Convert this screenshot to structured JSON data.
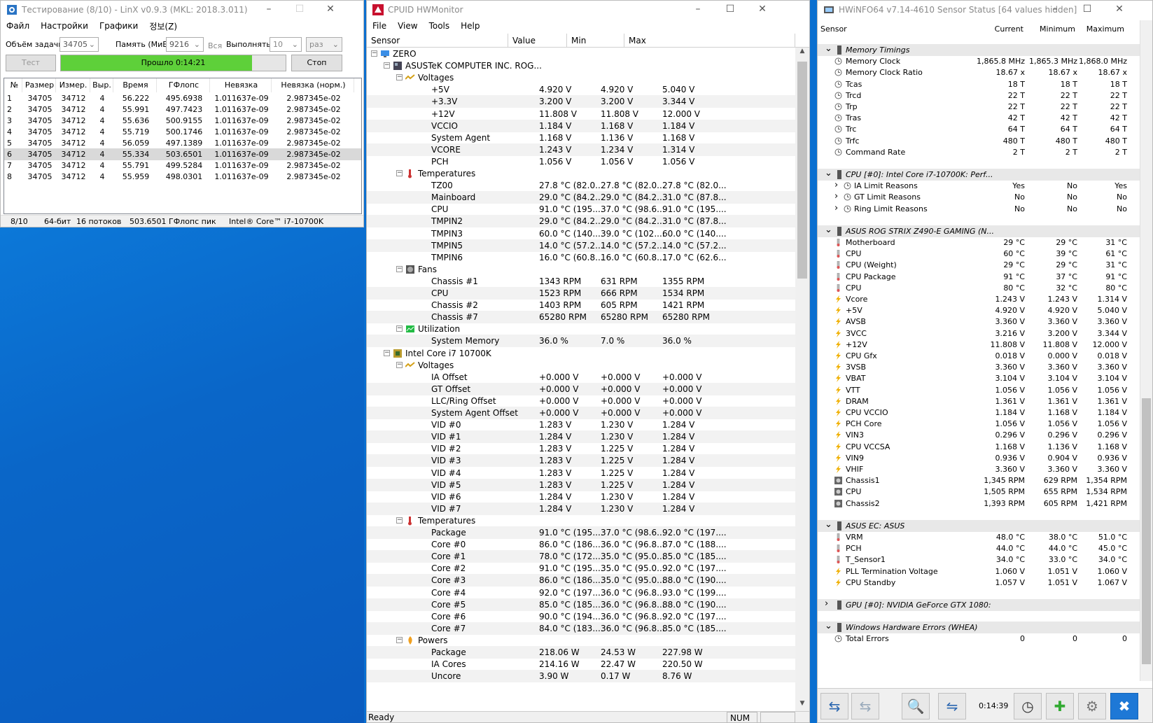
{
  "linx": {
    "title": "Тестирование (8/10) - LinX v0.9.3 (MKL: 2018.3.011)",
    "menu": [
      "Файл",
      "Настройки",
      "Графики",
      "정보(Z)"
    ],
    "task_size_label": "Объём задачи:",
    "task_size_value": "34705",
    "memory_label": "Память (МиБ):",
    "memory_value": "9216",
    "all_label": "Вся",
    "run_label": "Выполнять:",
    "run_value": "10",
    "run_unit": "раз",
    "test_button": "Тест",
    "progress_label": "Прошло 0:14:21",
    "progress_fraction": 0.85,
    "stop_button": "Стоп",
    "columns": [
      "№",
      "Размер",
      "Измер.",
      "Выр.",
      "Время",
      "ГФлопс",
      "Невязка",
      "Невязка (норм.)"
    ],
    "rows": [
      [
        "1",
        "34705",
        "34712",
        "4",
        "56.222",
        "495.6938",
        "1.011637e-09",
        "2.987345e-02"
      ],
      [
        "2",
        "34705",
        "34712",
        "4",
        "55.991",
        "497.7423",
        "1.011637e-09",
        "2.987345e-02"
      ],
      [
        "3",
        "34705",
        "34712",
        "4",
        "55.636",
        "500.9155",
        "1.011637e-09",
        "2.987345e-02"
      ],
      [
        "4",
        "34705",
        "34712",
        "4",
        "55.719",
        "500.1746",
        "1.011637e-09",
        "2.987345e-02"
      ],
      [
        "5",
        "34705",
        "34712",
        "4",
        "56.059",
        "497.1389",
        "1.011637e-09",
        "2.987345e-02"
      ],
      [
        "6",
        "34705",
        "34712",
        "4",
        "55.334",
        "503.6501",
        "1.011637e-09",
        "2.987345e-02"
      ],
      [
        "7",
        "34705",
        "34712",
        "4",
        "55.791",
        "499.5284",
        "1.011637e-09",
        "2.987345e-02"
      ],
      [
        "8",
        "34705",
        "34712",
        "4",
        "55.959",
        "498.0301",
        "1.011637e-09",
        "2.987345e-02"
      ]
    ],
    "status": [
      "8/10",
      "64-бит",
      "16 потоков",
      "503.6501 ГФлопс пик",
      "Intel® Core™ i7-10700K"
    ]
  },
  "hwmonitor": {
    "title": "CPUID HWMonitor",
    "menu": [
      "File",
      "View",
      "Tools",
      "Help"
    ],
    "columns": [
      "Sensor",
      "Value",
      "Min",
      "Max"
    ],
    "rows": [
      {
        "l": "ZERO",
        "d": 0,
        "t": "node",
        "ico": "pc"
      },
      {
        "l": "ASUSTeK COMPUTER INC. ROG...",
        "d": 1,
        "t": "node",
        "ico": "mb"
      },
      {
        "l": "Voltages",
        "d": 2,
        "t": "node",
        "ico": "volt"
      },
      {
        "l": "+5V",
        "d": 3,
        "v": "4.920 V",
        "mn": "4.920 V",
        "mx": "5.040 V"
      },
      {
        "l": "+3.3V",
        "d": 3,
        "v": "3.200 V",
        "mn": "3.200 V",
        "mx": "3.344 V"
      },
      {
        "l": "+12V",
        "d": 3,
        "v": "11.808 V",
        "mn": "11.808 V",
        "mx": "12.000 V"
      },
      {
        "l": "VCCIO",
        "d": 3,
        "v": "1.184 V",
        "mn": "1.168 V",
        "mx": "1.184 V"
      },
      {
        "l": "System Agent",
        "d": 3,
        "v": "1.168 V",
        "mn": "1.136 V",
        "mx": "1.168 V"
      },
      {
        "l": "VCORE",
        "d": 3,
        "v": "1.243 V",
        "mn": "1.234 V",
        "mx": "1.314 V"
      },
      {
        "l": "PCH",
        "d": 3,
        "v": "1.056 V",
        "mn": "1.056 V",
        "mx": "1.056 V"
      },
      {
        "l": "Temperatures",
        "d": 2,
        "t": "node",
        "ico": "temp"
      },
      {
        "l": "TZ00",
        "d": 3,
        "v": "27.8 °C (82.0...",
        "mn": "27.8 °C (82.0...",
        "mx": "27.8 °C (82.0..."
      },
      {
        "l": "Mainboard",
        "d": 3,
        "v": "29.0 °C (84.2...",
        "mn": "29.0 °C (84.2...",
        "mx": "31.0 °C (87.8..."
      },
      {
        "l": "CPU",
        "d": 3,
        "v": "91.0 °C (195....",
        "mn": "37.0 °C (98.6...",
        "mx": "91.0 °C (195...."
      },
      {
        "l": "TMPIN2",
        "d": 3,
        "v": "29.0 °C (84.2...",
        "mn": "29.0 °C (84.2...",
        "mx": "31.0 °C (87.8..."
      },
      {
        "l": "TMPIN3",
        "d": 3,
        "v": "60.0 °C (140....",
        "mn": "39.0 °C (102....",
        "mx": "60.0 °C (140...."
      },
      {
        "l": "TMPIN5",
        "d": 3,
        "v": "14.0 °C (57.2...",
        "mn": "14.0 °C (57.2...",
        "mx": "14.0 °C (57.2..."
      },
      {
        "l": "TMPIN6",
        "d": 3,
        "v": "16.0 °C (60.8...",
        "mn": "16.0 °C (60.8...",
        "mx": "17.0 °C (62.6..."
      },
      {
        "l": "Fans",
        "d": 2,
        "t": "node",
        "ico": "fan"
      },
      {
        "l": "Chassis #1",
        "d": 3,
        "v": "1343 RPM",
        "mn": "631 RPM",
        "mx": "1355 RPM"
      },
      {
        "l": "CPU",
        "d": 3,
        "v": "1523 RPM",
        "mn": "666 RPM",
        "mx": "1534 RPM"
      },
      {
        "l": "Chassis #2",
        "d": 3,
        "v": "1403 RPM",
        "mn": "605 RPM",
        "mx": "1421 RPM"
      },
      {
        "l": "Chassis #7",
        "d": 3,
        "v": "65280 RPM",
        "mn": "65280 RPM",
        "mx": "65280 RPM"
      },
      {
        "l": "Utilization",
        "d": 2,
        "t": "node",
        "ico": "util"
      },
      {
        "l": "System Memory",
        "d": 3,
        "v": "36.0 %",
        "mn": "7.0 %",
        "mx": "36.0 %"
      },
      {
        "l": "Intel Core i7 10700K",
        "d": 1,
        "t": "node",
        "ico": "cpu"
      },
      {
        "l": "Voltages",
        "d": 2,
        "t": "node",
        "ico": "volt"
      },
      {
        "l": "IA Offset",
        "d": 3,
        "v": "+0.000 V",
        "mn": "+0.000 V",
        "mx": "+0.000 V"
      },
      {
        "l": "GT Offset",
        "d": 3,
        "v": "+0.000 V",
        "mn": "+0.000 V",
        "mx": "+0.000 V"
      },
      {
        "l": "LLC/Ring Offset",
        "d": 3,
        "v": "+0.000 V",
        "mn": "+0.000 V",
        "mx": "+0.000 V"
      },
      {
        "l": "System Agent Offset",
        "d": 3,
        "v": "+0.000 V",
        "mn": "+0.000 V",
        "mx": "+0.000 V"
      },
      {
        "l": "VID #0",
        "d": 3,
        "v": "1.283 V",
        "mn": "1.230 V",
        "mx": "1.284 V"
      },
      {
        "l": "VID #1",
        "d": 3,
        "v": "1.284 V",
        "mn": "1.230 V",
        "mx": "1.284 V"
      },
      {
        "l": "VID #2",
        "d": 3,
        "v": "1.283 V",
        "mn": "1.225 V",
        "mx": "1.284 V"
      },
      {
        "l": "VID #3",
        "d": 3,
        "v": "1.283 V",
        "mn": "1.225 V",
        "mx": "1.284 V"
      },
      {
        "l": "VID #4",
        "d": 3,
        "v": "1.283 V",
        "mn": "1.225 V",
        "mx": "1.284 V"
      },
      {
        "l": "VID #5",
        "d": 3,
        "v": "1.283 V",
        "mn": "1.225 V",
        "mx": "1.284 V"
      },
      {
        "l": "VID #6",
        "d": 3,
        "v": "1.284 V",
        "mn": "1.230 V",
        "mx": "1.284 V"
      },
      {
        "l": "VID #7",
        "d": 3,
        "v": "1.284 V",
        "mn": "1.230 V",
        "mx": "1.284 V"
      },
      {
        "l": "Temperatures",
        "d": 2,
        "t": "node",
        "ico": "temp"
      },
      {
        "l": "Package",
        "d": 3,
        "v": "91.0 °C (195....",
        "mn": "37.0 °C (98.6...",
        "mx": "92.0 °C (197...."
      },
      {
        "l": "Core #0",
        "d": 3,
        "v": "86.0 °C (186....",
        "mn": "36.0 °C (96.8...",
        "mx": "87.0 °C (188...."
      },
      {
        "l": "Core #1",
        "d": 3,
        "v": "78.0 °C (172....",
        "mn": "35.0 °C (95.0...",
        "mx": "85.0 °C (185...."
      },
      {
        "l": "Core #2",
        "d": 3,
        "v": "91.0 °C (195....",
        "mn": "35.0 °C (95.0...",
        "mx": "92.0 °C (197...."
      },
      {
        "l": "Core #3",
        "d": 3,
        "v": "86.0 °C (186....",
        "mn": "35.0 °C (95.0...",
        "mx": "88.0 °C (190...."
      },
      {
        "l": "Core #4",
        "d": 3,
        "v": "92.0 °C (197....",
        "mn": "36.0 °C (96.8...",
        "mx": "93.0 °C (199...."
      },
      {
        "l": "Core #5",
        "d": 3,
        "v": "85.0 °C (185....",
        "mn": "36.0 °C (96.8...",
        "mx": "88.0 °C (190...."
      },
      {
        "l": "Core #6",
        "d": 3,
        "v": "90.0 °C (194....",
        "mn": "36.0 °C (96.8...",
        "mx": "92.0 °C (197...."
      },
      {
        "l": "Core #7",
        "d": 3,
        "v": "84.0 °C (183....",
        "mn": "36.0 °C (96.8...",
        "mx": "85.0 °C (185...."
      },
      {
        "l": "Powers",
        "d": 2,
        "t": "node",
        "ico": "power"
      },
      {
        "l": "Package",
        "d": 3,
        "v": "218.06 W",
        "mn": "24.53 W",
        "mx": "227.98 W"
      },
      {
        "l": "IA Cores",
        "d": 3,
        "v": "214.16 W",
        "mn": "22.47 W",
        "mx": "220.50 W"
      },
      {
        "l": "Uncore",
        "d": 3,
        "v": "3.90 W",
        "mn": "0.17 W",
        "mx": "8.76 W"
      }
    ],
    "status_ready": "Ready",
    "status_num": "NUM"
  },
  "hwinfo": {
    "title": "HWiNFO64 v7.14-4610 Sensor Status [64 values hidden]",
    "columns": [
      "Sensor",
      "Current",
      "Minimum",
      "Maximum"
    ],
    "rows": [
      {
        "t": "grp",
        "n": "Memory Timings"
      },
      {
        "n": "Memory Clock",
        "a": "1,865.8 MHz",
        "b": "1,865.3 MHz",
        "c": "1,868.0 MHz",
        "i": "clock"
      },
      {
        "n": "Memory Clock Ratio",
        "a": "18.67 x",
        "b": "18.67 x",
        "c": "18.67 x",
        "i": "clock"
      },
      {
        "n": "Tcas",
        "a": "18 T",
        "b": "18 T",
        "c": "18 T",
        "i": "clock"
      },
      {
        "n": "Trcd",
        "a": "22 T",
        "b": "22 T",
        "c": "22 T",
        "i": "clock"
      },
      {
        "n": "Trp",
        "a": "22 T",
        "b": "22 T",
        "c": "22 T",
        "i": "clock"
      },
      {
        "n": "Tras",
        "a": "42 T",
        "b": "42 T",
        "c": "42 T",
        "i": "clock"
      },
      {
        "n": "Trc",
        "a": "64 T",
        "b": "64 T",
        "c": "64 T",
        "i": "clock"
      },
      {
        "n": "Trfc",
        "a": "480 T",
        "b": "480 T",
        "c": "480 T",
        "i": "clock"
      },
      {
        "n": "Command Rate",
        "a": "2 T",
        "b": "2 T",
        "c": "2 T",
        "i": "clock"
      },
      {
        "t": "gap"
      },
      {
        "t": "grp",
        "n": "CPU [#0]: Intel Core i7-10700K: Perf..."
      },
      {
        "n": "IA Limit Reasons",
        "a": "Yes",
        "b": "No",
        "c": "Yes",
        "i": "clock",
        "e": true
      },
      {
        "n": "GT Limit Reasons",
        "a": "No",
        "b": "No",
        "c": "No",
        "i": "clock",
        "e": true
      },
      {
        "n": "Ring Limit Reasons",
        "a": "No",
        "b": "No",
        "c": "No",
        "i": "clock",
        "e": true
      },
      {
        "t": "gap"
      },
      {
        "t": "grp",
        "n": "ASUS ROG STRIX Z490-E GAMING (N..."
      },
      {
        "n": "Motherboard",
        "a": "29 °C",
        "b": "29 °C",
        "c": "31 °C",
        "i": "therm"
      },
      {
        "n": "CPU",
        "a": "60 °C",
        "b": "39 °C",
        "c": "61 °C",
        "i": "therm"
      },
      {
        "n": "CPU (Weight)",
        "a": "29 °C",
        "b": "29 °C",
        "c": "31 °C",
        "i": "therm"
      },
      {
        "n": "CPU Package",
        "a": "91 °C",
        "b": "37 °C",
        "c": "91 °C",
        "i": "therm"
      },
      {
        "n": "CPU",
        "a": "80 °C",
        "b": "32 °C",
        "c": "80 °C",
        "i": "therm"
      },
      {
        "n": "Vcore",
        "a": "1.243 V",
        "b": "1.243 V",
        "c": "1.314 V",
        "i": "volt"
      },
      {
        "n": "+5V",
        "a": "4.920 V",
        "b": "4.920 V",
        "c": "5.040 V",
        "i": "volt"
      },
      {
        "n": "AVSB",
        "a": "3.360 V",
        "b": "3.360 V",
        "c": "3.360 V",
        "i": "volt"
      },
      {
        "n": "3VCC",
        "a": "3.216 V",
        "b": "3.200 V",
        "c": "3.344 V",
        "i": "volt"
      },
      {
        "n": "+12V",
        "a": "11.808 V",
        "b": "11.808 V",
        "c": "12.000 V",
        "i": "volt"
      },
      {
        "n": "CPU Gfx",
        "a": "0.018 V",
        "b": "0.000 V",
        "c": "0.018 V",
        "i": "volt"
      },
      {
        "n": "3VSB",
        "a": "3.360 V",
        "b": "3.360 V",
        "c": "3.360 V",
        "i": "volt"
      },
      {
        "n": "VBAT",
        "a": "3.104 V",
        "b": "3.104 V",
        "c": "3.104 V",
        "i": "volt"
      },
      {
        "n": "VTT",
        "a": "1.056 V",
        "b": "1.056 V",
        "c": "1.056 V",
        "i": "volt"
      },
      {
        "n": "DRAM",
        "a": "1.361 V",
        "b": "1.361 V",
        "c": "1.361 V",
        "i": "volt"
      },
      {
        "n": "CPU VCCIO",
        "a": "1.184 V",
        "b": "1.168 V",
        "c": "1.184 V",
        "i": "volt"
      },
      {
        "n": "PCH Core",
        "a": "1.056 V",
        "b": "1.056 V",
        "c": "1.056 V",
        "i": "volt"
      },
      {
        "n": "VIN3",
        "a": "0.296 V",
        "b": "0.296 V",
        "c": "0.296 V",
        "i": "volt"
      },
      {
        "n": "CPU VCCSA",
        "a": "1.168 V",
        "b": "1.136 V",
        "c": "1.168 V",
        "i": "volt"
      },
      {
        "n": "VIN9",
        "a": "0.936 V",
        "b": "0.904 V",
        "c": "0.936 V",
        "i": "volt"
      },
      {
        "n": "VHIF",
        "a": "3.360 V",
        "b": "3.360 V",
        "c": "3.360 V",
        "i": "volt"
      },
      {
        "n": "Chassis1",
        "a": "1,345 RPM",
        "b": "629 RPM",
        "c": "1,354 RPM",
        "i": "fan"
      },
      {
        "n": "CPU",
        "a": "1,505 RPM",
        "b": "655 RPM",
        "c": "1,534 RPM",
        "i": "fan"
      },
      {
        "n": "Chassis2",
        "a": "1,393 RPM",
        "b": "605 RPM",
        "c": "1,421 RPM",
        "i": "fan"
      },
      {
        "t": "gap"
      },
      {
        "t": "grp",
        "n": "ASUS EC: ASUS"
      },
      {
        "n": "VRM",
        "a": "48.0 °C",
        "b": "38.0 °C",
        "c": "51.0 °C",
        "i": "therm"
      },
      {
        "n": "PCH",
        "a": "44.0 °C",
        "b": "44.0 °C",
        "c": "45.0 °C",
        "i": "therm"
      },
      {
        "n": "T_Sensor1",
        "a": "34.0 °C",
        "b": "33.0 °C",
        "c": "34.0 °C",
        "i": "therm"
      },
      {
        "n": "PLL Termination Voltage",
        "a": "1.060 V",
        "b": "1.051 V",
        "c": "1.060 V",
        "i": "volt"
      },
      {
        "n": "CPU Standby",
        "a": "1.057 V",
        "b": "1.051 V",
        "c": "1.067 V",
        "i": "volt"
      },
      {
        "t": "gap"
      },
      {
        "t": "grp",
        "n": "GPU [#0]: NVIDIA GeForce GTX 1080:",
        "collapsed": true
      },
      {
        "t": "gap"
      },
      {
        "t": "grp",
        "n": "Windows Hardware Errors (WHEA)"
      },
      {
        "n": "Total Errors",
        "a": "0",
        "b": "0",
        "c": "0",
        "i": "clock"
      }
    ],
    "timer": "0:14:39"
  },
  "colors": {
    "progress_green": "#5ed03a",
    "accent_blue": "#1e78d6",
    "close_red": "#e81123"
  }
}
